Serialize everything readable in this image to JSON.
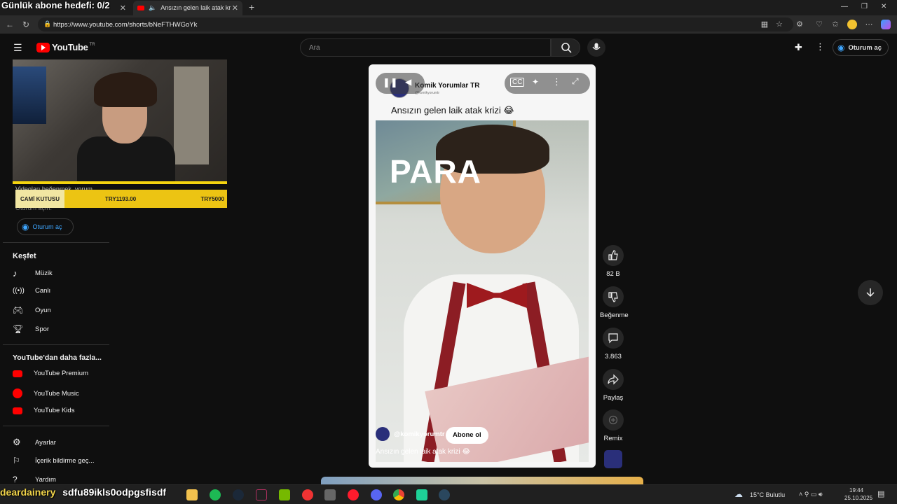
{
  "stream_overlay": {
    "goal_text": "Günlük abone hedefi: 0/2",
    "chat_line_user": "deardainery",
    "chat_line_text": "sdfu89ikls0odpgsfisdf"
  },
  "browser": {
    "tabs": [
      {
        "label": "Ansızın gelen laik atak krizi 😂",
        "active": true,
        "muted_icon": "speaker-icon"
      }
    ],
    "url": "https://www.youtube.com/shorts/bNeFTHWGoYk"
  },
  "masthead": {
    "logo_text": "YouTube",
    "region": "TR",
    "search_placeholder": "Ara",
    "signin_label": "Oturum aç"
  },
  "donation": {
    "label": "CAMİ KUTUSU",
    "current": "TRY1193.00",
    "goal": "TRY5000"
  },
  "sidebar": {
    "ghost_text_1": "Videoları beğenmek, yorum",
    "ghost_text_2": "Oturum açın.",
    "signin_label": "Oturum aç",
    "explore_heading": "Keşfet",
    "explore_items": [
      {
        "label": "Müzik",
        "icon": "music-note-icon"
      },
      {
        "label": "Canlı",
        "icon": "live-icon"
      },
      {
        "label": "Oyun",
        "icon": "gamepad-icon"
      },
      {
        "label": "Spor",
        "icon": "trophy-icon"
      }
    ],
    "more_heading": "YouTube'dan daha fazla...",
    "more_items": [
      {
        "label": "YouTube Premium"
      },
      {
        "label": "YouTube Music"
      },
      {
        "label": "YouTube Kids"
      }
    ],
    "footer_items": [
      {
        "label": "Ayarlar",
        "icon": "gear-icon"
      },
      {
        "label": "İçerik bildirme geç...",
        "icon": "flag-icon"
      },
      {
        "label": "Yardım",
        "icon": "help-icon"
      }
    ]
  },
  "short": {
    "channel_name": "Komik Yorumlar TR",
    "channel_handle": "@komikyorumtr",
    "title": "Ansızın gelen laik atak krizi 😂",
    "video_overlay_text": "PARA",
    "bottom_handle": "@komikyorumtr",
    "subscribe_label": "Abone ol",
    "bottom_title": "Ansızın gelen laik atak krizi 😂"
  },
  "actions": {
    "like_count": "82 B",
    "dislike_label": "Beğenme",
    "comment_count": "3.863",
    "share_label": "Paylaş",
    "remix_label": "Remix"
  },
  "taskbar": {
    "weather": "15°C  Bulutlu",
    "time": "19:44",
    "date": "25.10.2025"
  },
  "colors": {
    "yt_red": "#ff0000",
    "link_blue": "#3ea6ff",
    "donation_yellow": "#ecc413"
  }
}
